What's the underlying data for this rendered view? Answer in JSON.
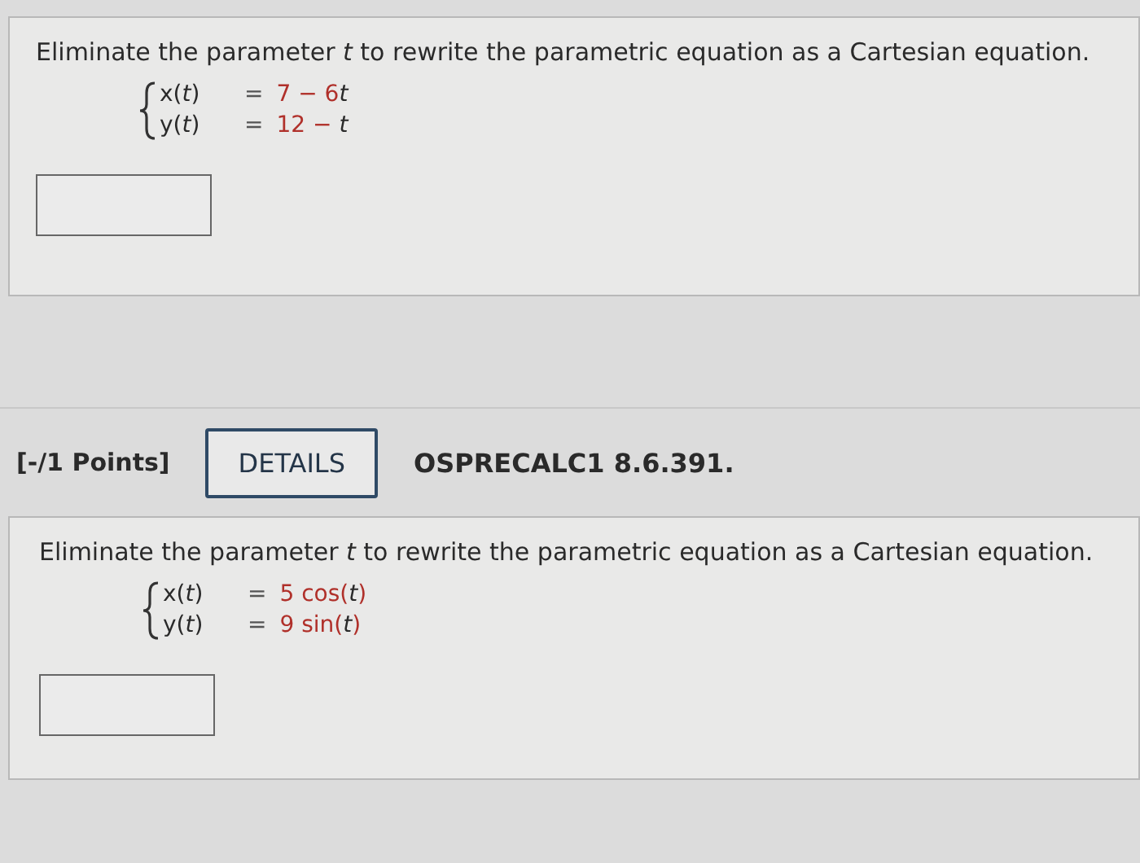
{
  "questions": [
    {
      "prompt": "Eliminate the parameter *t* to rewrite the parametric equation as a Cartesian equation.",
      "equations": [
        {
          "lhs": "x(*t*)",
          "eq": "=",
          "rhs": [
            {
              "kind": "num",
              "text": "7 − 6"
            },
            {
              "kind": "var",
              "text": "t"
            }
          ]
        },
        {
          "lhs": "y(*t*)",
          "eq": "=",
          "rhs": [
            {
              "kind": "num",
              "text": "12 − "
            },
            {
              "kind": "var",
              "text": "t"
            }
          ]
        }
      ]
    },
    {
      "header": {
        "points": "[-/1 Points]",
        "button": "DETAILS",
        "code": "OSPRECALC1 8.6.391."
      },
      "prompt": "Eliminate the parameter *t* to rewrite the parametric equation as a Cartesian equation.",
      "equations": [
        {
          "lhs": "x(*t*)",
          "eq": "=",
          "rhs": [
            {
              "kind": "num",
              "text": "5 cos("
            },
            {
              "kind": "var",
              "text": "t"
            },
            {
              "kind": "num",
              "text": ")"
            }
          ]
        },
        {
          "lhs": "y(*t*)",
          "eq": "=",
          "rhs": [
            {
              "kind": "num",
              "text": "9 sin("
            },
            {
              "kind": "var",
              "text": "t"
            },
            {
              "kind": "num",
              "text": ")"
            }
          ]
        }
      ]
    }
  ]
}
